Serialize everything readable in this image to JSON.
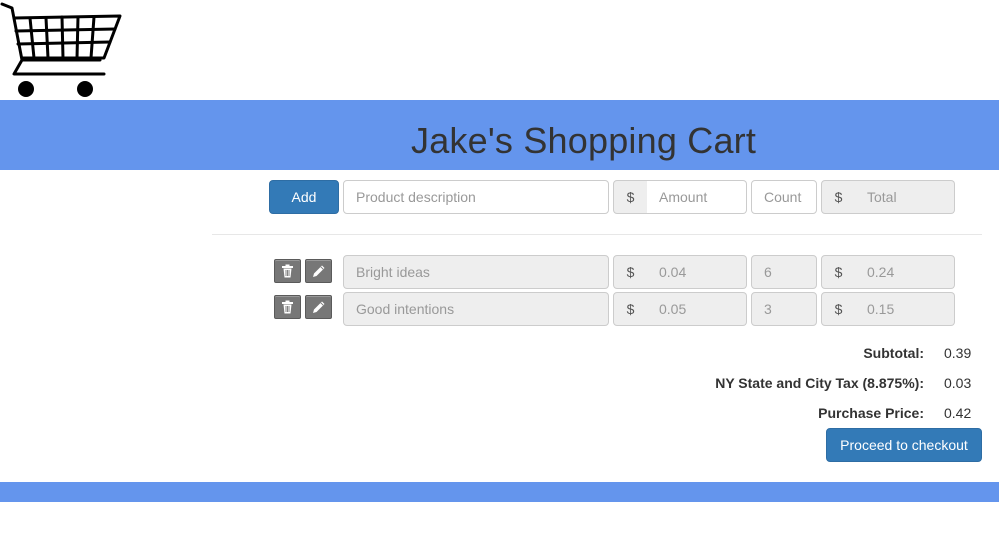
{
  "header": {
    "title": "Jake's Shopping Cart",
    "logo_icon": "shopping-cart-icon"
  },
  "entry": {
    "add_label": "Add",
    "description_placeholder": "Product description",
    "currency_symbol": "$",
    "amount_placeholder": "Amount",
    "count_placeholder": "Count",
    "total_placeholder": "Total"
  },
  "items": [
    {
      "description": "Bright ideas",
      "currency": "$",
      "amount": "0.04",
      "count": "6",
      "total": "0.24",
      "delete_icon": "trash-icon",
      "edit_icon": "pencil-icon"
    },
    {
      "description": "Good intentions",
      "currency": "$",
      "amount": "0.05",
      "count": "3",
      "total": "0.15",
      "delete_icon": "trash-icon",
      "edit_icon": "pencil-icon"
    }
  ],
  "summary": {
    "subtotal_label": "Subtotal:",
    "subtotal_value": "0.39",
    "tax_label": "NY State and City Tax (8.875%):",
    "tax_value": "0.03",
    "purchase_label": "Purchase Price:",
    "purchase_value": "0.42"
  },
  "checkout_label": "Proceed to checkout",
  "colors": {
    "banner": "#6495ed",
    "primary": "#337ab7"
  }
}
